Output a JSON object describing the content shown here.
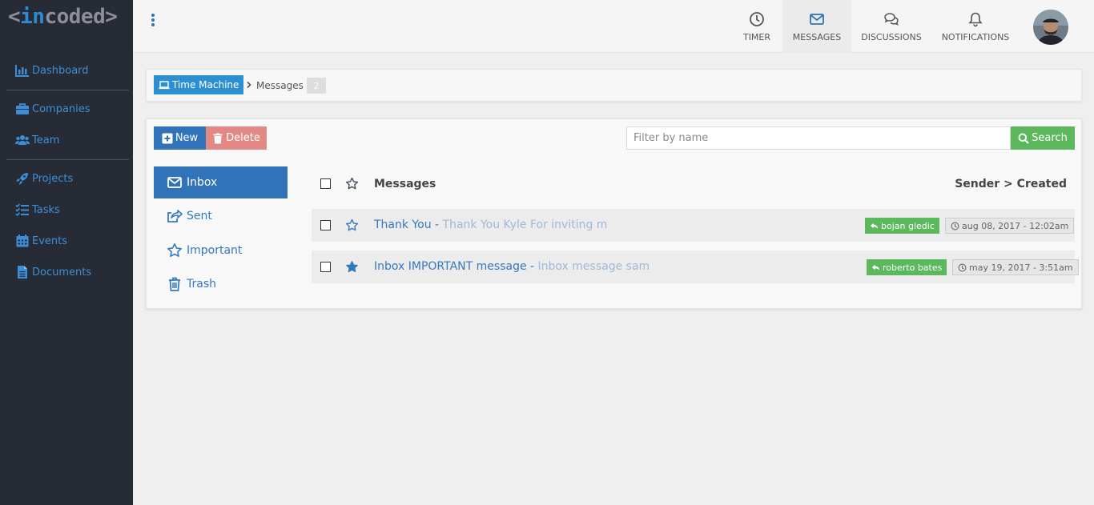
{
  "app": {
    "logo_open": "<",
    "logo_in": "in",
    "logo_rest": "coded",
    "logo_close": ">"
  },
  "sidebar": {
    "items": [
      {
        "label": "Dashboard",
        "icon": "bar-chart-icon"
      },
      {
        "label": "Companies",
        "icon": "briefcase-icon"
      },
      {
        "label": "Team",
        "icon": "users-icon"
      },
      {
        "label": "Projects",
        "icon": "rocket-icon"
      },
      {
        "label": "Tasks",
        "icon": "tasks-icon"
      },
      {
        "label": "Events",
        "icon": "calendar-icon"
      },
      {
        "label": "Documents",
        "icon": "document-icon"
      }
    ]
  },
  "topbar": {
    "tabs": [
      {
        "label": "TIMER",
        "icon": "clock-icon"
      },
      {
        "label": "MESSAGES",
        "icon": "envelope-icon",
        "active": true
      },
      {
        "label": "DISCUSSIONS",
        "icon": "chat-bubbles-icon"
      },
      {
        "label": "NOTIFICATIONS",
        "icon": "bell-icon"
      }
    ]
  },
  "breadcrumb": {
    "root": "Time Machine",
    "current": "Messages",
    "count": "2"
  },
  "toolbar": {
    "new_label": "New",
    "delete_label": "Delete",
    "filter_placeholder": "Filter by name",
    "search_label": "Search"
  },
  "folders": [
    {
      "label": "Inbox",
      "active": true
    },
    {
      "label": "Sent"
    },
    {
      "label": "Important"
    },
    {
      "label": "Trash"
    }
  ],
  "list": {
    "header_messages": "Messages",
    "header_sort": "Sender > Created",
    "rows": [
      {
        "subject": "Thank You",
        "separator": " - ",
        "preview": "Thank You Kyle For inviting m",
        "sender": "bojan gledic",
        "date": "aug 08, 2017 - 12:02am",
        "starred": false
      },
      {
        "subject": "Inbox IMPORTANT message",
        "separator": " - ",
        "preview": "Inbox message sam",
        "sender": "roberto bates",
        "date": "may 19, 2017 - 3:51am",
        "starred": true
      }
    ]
  },
  "colors": {
    "sidebar_bg": "#272b36",
    "accent_blue": "#3173b8",
    "link_blue": "#3c8fd6",
    "success_green": "#5cb85c",
    "danger_red": "#e38985"
  }
}
